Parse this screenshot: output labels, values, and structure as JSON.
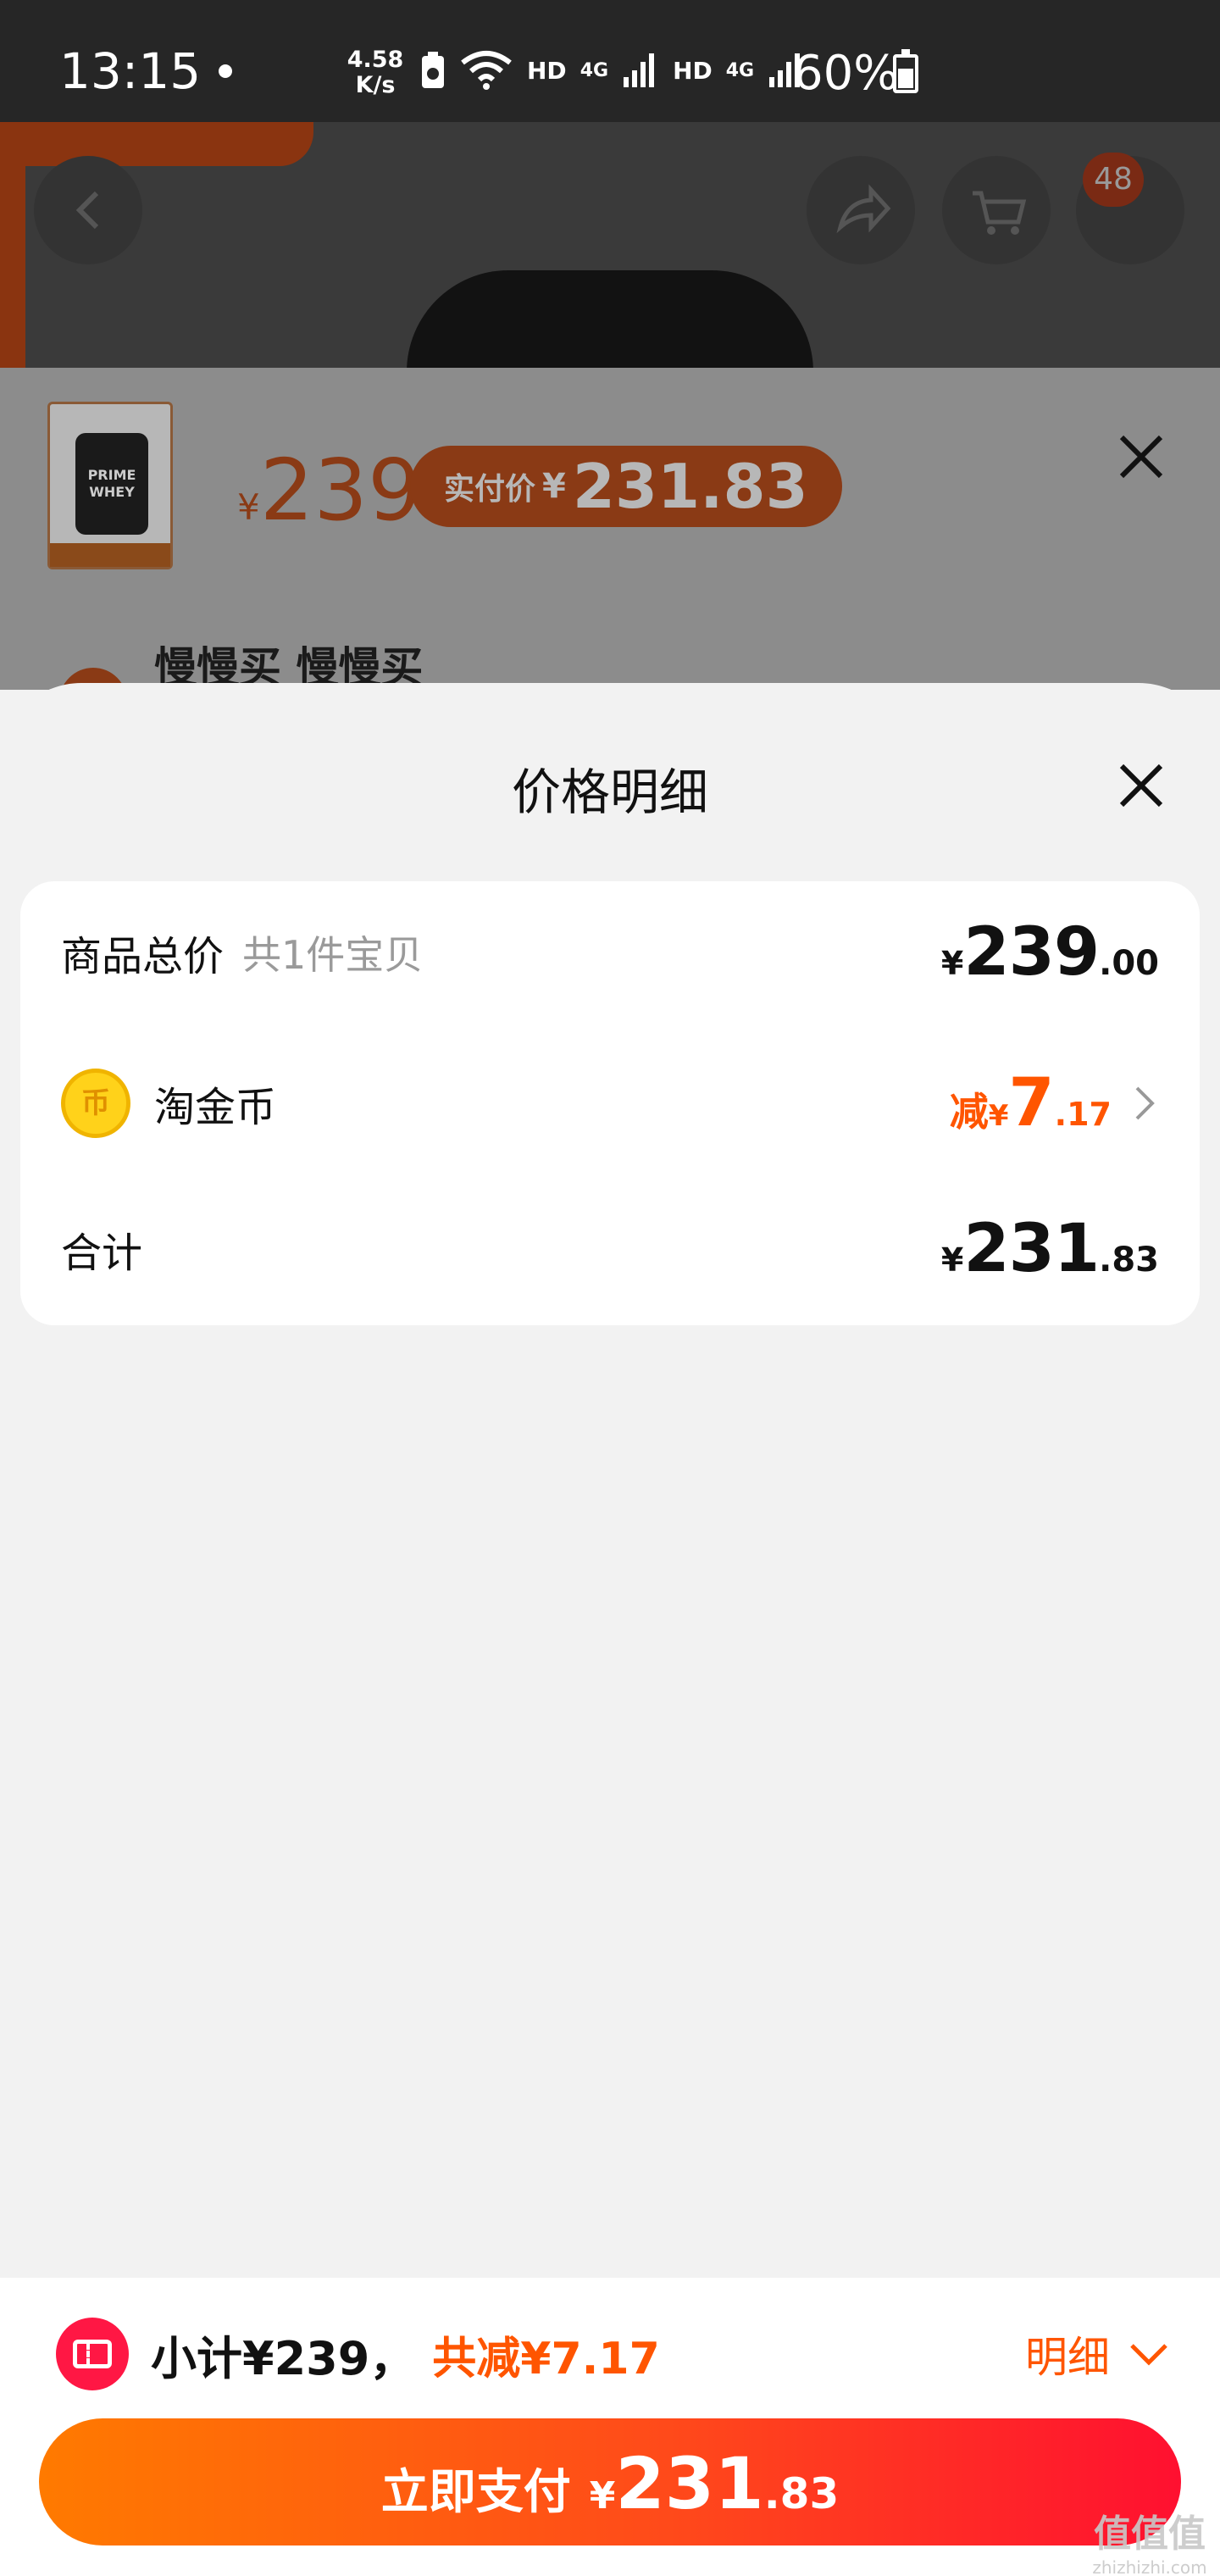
{
  "status_bar": {
    "time": "13:15",
    "net_speed_value": "4.58",
    "net_speed_unit": "K/s",
    "hd1": "HD",
    "net1": "4G",
    "hd2": "HD",
    "net2": "4G",
    "battery": "60%"
  },
  "product_sku": {
    "price_currency": "¥",
    "price": "239",
    "actual_label": "实付价",
    "actual_currency": "¥",
    "actual_price": "231.83",
    "thumb_text_1": "PRIME",
    "thumb_text_2": "WHEY",
    "title": "慢慢买 慢慢买",
    "cart_badge": "48"
  },
  "sheet": {
    "title": "价格明细"
  },
  "breakdown": {
    "goods_label": "商品总价",
    "goods_count": "共1件宝贝",
    "goods_currency": "¥",
    "goods_int": "239",
    "goods_dec": ".00",
    "coin_label": "淘金币",
    "coin_glyph": "币",
    "coin_prefix": "减",
    "coin_currency": "¥",
    "coin_int": "7",
    "coin_dec": ".17",
    "total_label": "合计",
    "total_currency": "¥",
    "total_int": "231",
    "total_dec": ".83"
  },
  "footer": {
    "subtotal": "小计¥239，",
    "saved": "共减¥7.17",
    "detail_label": "明细",
    "pay_label": "立即支付",
    "pay_currency": "¥",
    "pay_int": "231",
    "pay_dec": ".83"
  },
  "watermark": {
    "main": "值值值",
    "sub": "zhizhizhi.com"
  },
  "colors": {
    "accent_orange": "#ff5500",
    "pay_gradient_start": "#ff7a00",
    "pay_gradient_end": "#ff1030",
    "coin_gold": "#ffd21a"
  }
}
